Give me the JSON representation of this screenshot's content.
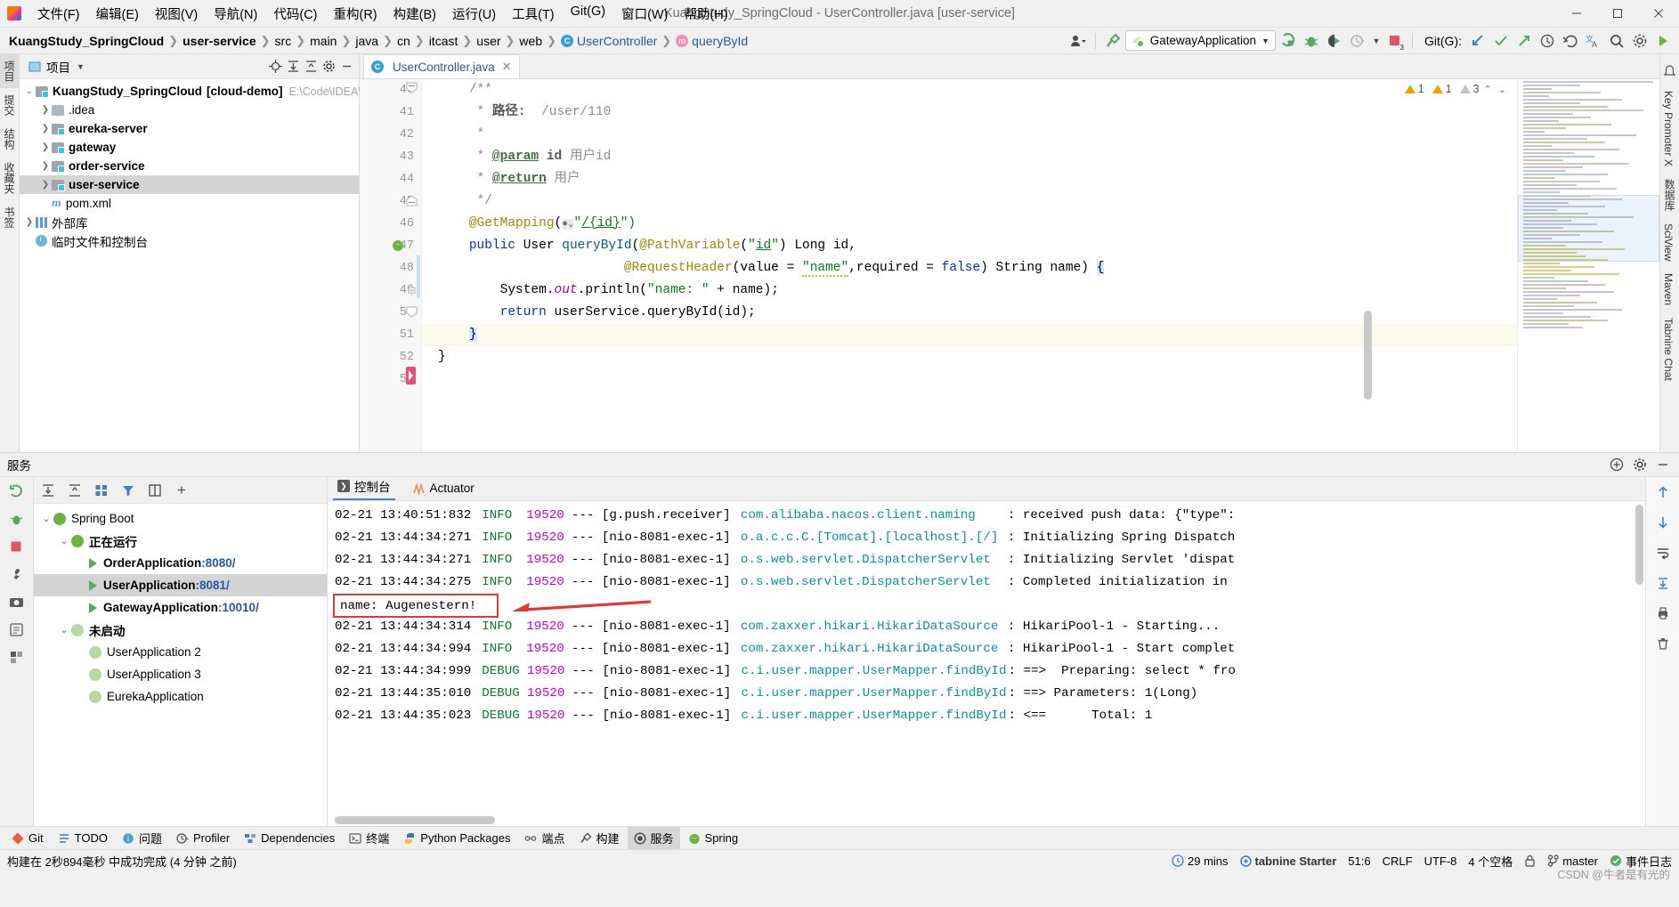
{
  "window": {
    "title": "KuangStudy_SpringCloud - UserController.java [user-service]",
    "minimize": "—",
    "maximize": "☐",
    "close": "✕"
  },
  "menu": [
    {
      "label": "文件(F)"
    },
    {
      "label": "编辑(E)"
    },
    {
      "label": "视图(V)"
    },
    {
      "label": "导航(N)"
    },
    {
      "label": "代码(C)"
    },
    {
      "label": "重构(R)"
    },
    {
      "label": "构建(B)"
    },
    {
      "label": "运行(U)"
    },
    {
      "label": "工具(T)"
    },
    {
      "label": "Git(G)"
    },
    {
      "label": "窗口(W)"
    },
    {
      "label": "帮助(H)"
    }
  ],
  "breadcrumbs": [
    {
      "label": "KuangStudy_SpringCloud",
      "bold": true
    },
    {
      "label": "user-service",
      "bold": true
    },
    {
      "label": "src"
    },
    {
      "label": "main"
    },
    {
      "label": "java"
    },
    {
      "label": "cn"
    },
    {
      "label": "itcast"
    },
    {
      "label": "user"
    },
    {
      "label": "web"
    },
    {
      "label": "UserController",
      "icon": "class-icon"
    },
    {
      "label": "queryById",
      "icon": "method-icon"
    }
  ],
  "toolbar": {
    "run_config": "GatewayApplication",
    "git_label": "Git(G):",
    "icons": [
      "profile-icon",
      "build-hammer-icon",
      "run-icon",
      "debug-icon",
      "run-with-coverage-icon",
      "profiler-icon",
      "stop-icon",
      "git-update-icon",
      "git-commit-icon",
      "git-push-icon",
      "history-icon",
      "undo-icon",
      "translate-icon",
      "search-icon",
      "settings-icon",
      "ide-icon"
    ],
    "stop_badge": "3"
  },
  "left_rail": [
    {
      "label": "项目",
      "active": true
    },
    {
      "label": "提交"
    },
    {
      "label": "结构"
    },
    {
      "label": "收藏夹"
    },
    {
      "label": "书签"
    }
  ],
  "right_rail": [
    {
      "label": "Key Promoter X"
    },
    {
      "label": "数据库"
    },
    {
      "label": "SciView"
    },
    {
      "label": "Maven"
    },
    {
      "label": "Tabnine Chat"
    }
  ],
  "project_panel": {
    "title": "项目",
    "header_icons": [
      "locate-icon",
      "expand-all-icon",
      "collapse-all-icon",
      "settings-gear-icon",
      "hide-icon"
    ],
    "tree": [
      {
        "level": 0,
        "arrow": "down",
        "icon": "module-folder",
        "label": "KuangStudy_SpringCloud",
        "bracket": "[cloud-demo]",
        "path": "E:\\Code\\IDEA\\Ku",
        "bold": true
      },
      {
        "level": 1,
        "arrow": "right",
        "icon": "plain-folder",
        "label": ".idea",
        "bold": false
      },
      {
        "level": 1,
        "arrow": "right",
        "icon": "module-folder",
        "label": "eureka-server",
        "bold": true
      },
      {
        "level": 1,
        "arrow": "right",
        "icon": "module-folder",
        "label": "gateway",
        "bold": true
      },
      {
        "level": 1,
        "arrow": "right",
        "icon": "module-folder",
        "label": "order-service",
        "bold": true
      },
      {
        "level": 1,
        "arrow": "right",
        "icon": "module-folder",
        "label": "user-service",
        "bold": true,
        "selected": true
      },
      {
        "level": 1,
        "arrow": "none",
        "icon": "maven-icon",
        "label": "pom.xml",
        "bold": false
      },
      {
        "level": 0,
        "arrow": "right",
        "icon": "library-icon",
        "label": "外部库",
        "bold": false
      },
      {
        "level": 0,
        "arrow": "none",
        "icon": "scratches-icon",
        "label": "临时文件和控制台",
        "bold": false
      }
    ]
  },
  "editor": {
    "tab": {
      "label": "UserController.java",
      "icon": "class-icon",
      "close": "✕"
    },
    "inspections": {
      "warnings": "1",
      "weak_warnings": "1",
      "typos": "3"
    },
    "first_line": 40,
    "lines": [
      {
        "n": 40,
        "tokens": [
          {
            "t": "    ",
            "c": "plain"
          },
          {
            "t": "/**",
            "c": "cmt"
          }
        ]
      },
      {
        "n": 41,
        "tokens": [
          {
            "t": "     * ",
            "c": "cmt"
          },
          {
            "t": "路径:",
            "c": "cmt-b"
          },
          {
            "t": "  /user/110",
            "c": "cmt"
          }
        ]
      },
      {
        "n": 42,
        "tokens": [
          {
            "t": "     *",
            "c": "cmt"
          }
        ]
      },
      {
        "n": 43,
        "tokens": [
          {
            "t": "     * ",
            "c": "cmt"
          },
          {
            "t": "@param",
            "c": "cmt-tag"
          },
          {
            "t": " ",
            "c": "cmt"
          },
          {
            "t": "id",
            "c": "cmt-b"
          },
          {
            "t": " 用户id",
            "c": "cmt"
          }
        ]
      },
      {
        "n": 44,
        "tokens": [
          {
            "t": "     * ",
            "c": "cmt"
          },
          {
            "t": "@return",
            "c": "cmt-tag"
          },
          {
            "t": " 用户",
            "c": "cmt"
          }
        ]
      },
      {
        "n": 45,
        "tokens": [
          {
            "t": "     */",
            "c": "cmt"
          }
        ]
      },
      {
        "n": 46,
        "tokens": [
          {
            "t": "    ",
            "c": "plain"
          },
          {
            "t": "@GetMapping",
            "c": "ann"
          },
          {
            "t": "(",
            "c": "plain"
          },
          {
            "t": "●⌄",
            "c": "gutter-web"
          },
          {
            "t": "\"",
            "c": "str"
          },
          {
            "t": "/{id}",
            "c": "ustr"
          },
          {
            "t": "\")",
            "c": "str"
          }
        ]
      },
      {
        "n": 47,
        "tokens": [
          {
            "t": "    ",
            "c": "plain"
          },
          {
            "t": "public",
            "c": "kw"
          },
          {
            "t": " User ",
            "c": "typ"
          },
          {
            "t": "queryById",
            "c": "fn"
          },
          {
            "t": "(",
            "c": "plain"
          },
          {
            "t": "@PathVariable",
            "c": "ann"
          },
          {
            "t": "(",
            "c": "plain"
          },
          {
            "t": "\"",
            "c": "str"
          },
          {
            "t": "id",
            "c": "ustr"
          },
          {
            "t": "\"",
            "c": "str"
          },
          {
            "t": ") Long id,",
            "c": "plain"
          }
        ]
      },
      {
        "n": 48,
        "tokens": [
          {
            "t": "                        ",
            "c": "plain"
          },
          {
            "t": "@RequestHeader",
            "c": "ann"
          },
          {
            "t": "(value = ",
            "c": "plain"
          },
          {
            "t": "\"name\"",
            "c": "str-wavy"
          },
          {
            "t": ",required = ",
            "c": "plain"
          },
          {
            "t": "false",
            "c": "kw"
          },
          {
            "t": ") String name) ",
            "c": "plain"
          },
          {
            "t": "{",
            "c": "brace"
          }
        ]
      },
      {
        "n": 49,
        "tokens": [
          {
            "t": "        System.",
            "c": "plain"
          },
          {
            "t": "out",
            "c": "fld-i"
          },
          {
            "t": ".println(",
            "c": "plain"
          },
          {
            "t": "\"name: \"",
            "c": "str"
          },
          {
            "t": " + name);",
            "c": "plain"
          }
        ]
      },
      {
        "n": 50,
        "tokens": [
          {
            "t": "        ",
            "c": "plain"
          },
          {
            "t": "return",
            "c": "kw"
          },
          {
            "t": " userService.queryById(id);",
            "c": "plain"
          }
        ]
      },
      {
        "n": 51,
        "tokens": [
          {
            "t": "    ",
            "c": "plain"
          },
          {
            "t": "}",
            "c": "brace"
          }
        ],
        "highlight": true
      },
      {
        "n": 52,
        "tokens": [
          {
            "t": "}",
            "c": "plain"
          }
        ]
      },
      {
        "n": 53,
        "tokens": [
          {
            "t": "",
            "c": "plain"
          }
        ]
      }
    ]
  },
  "services": {
    "title": "服务",
    "header_icons": [
      "add-service-icon",
      "settings-gear-icon",
      "hide-icon"
    ],
    "toolbar_icons": [
      "rerun-icon",
      "debug-icon",
      "stop-icon",
      "wrench-icon",
      "camera-icon",
      "dump-icon",
      "layout-icon"
    ],
    "filter_icons": [
      "expand-all-icon",
      "collapse-all-icon",
      "group-icon",
      "filter-icon",
      "split-icon",
      "add-icon"
    ],
    "tree": [
      {
        "level": 0,
        "arrow": "down",
        "icon": "spring-boot-icon",
        "label": "Spring Boot"
      },
      {
        "level": 1,
        "arrow": "down",
        "icon": "running-icon",
        "label": "正在运行",
        "bold": true
      },
      {
        "level": 2,
        "arrow": "none",
        "icon": "play-icon",
        "label": "OrderApplication",
        "port": ":8080/",
        "bold": true
      },
      {
        "level": 2,
        "arrow": "none",
        "icon": "play-icon",
        "label": "UserApplication",
        "port": ":8081/",
        "bold": true,
        "selected": true
      },
      {
        "level": 2,
        "arrow": "none",
        "icon": "play-icon",
        "label": "GatewayApplication",
        "port": ":10010/",
        "bold": true
      },
      {
        "level": 1,
        "arrow": "down",
        "icon": "stopped-icon",
        "label": "未启动",
        "bold": true
      },
      {
        "level": 2,
        "arrow": "none",
        "icon": "spring-dim-icon",
        "label": "UserApplication 2"
      },
      {
        "level": 2,
        "arrow": "none",
        "icon": "spring-dim-icon",
        "label": "UserApplication 3"
      },
      {
        "level": 2,
        "arrow": "none",
        "icon": "spring-dim-icon",
        "label": "EurekaApplication"
      }
    ],
    "tabs": [
      {
        "label": "控制台",
        "icon": "console-icon",
        "active": true
      },
      {
        "label": "Actuator",
        "icon": "actuator-icon",
        "active": false
      }
    ],
    "right_icons": [
      "scroll-up-icon",
      "scroll-down-icon",
      "soft-wrap-icon",
      "scroll-end-icon",
      "print-icon",
      "trash-icon"
    ],
    "log_lines": [
      {
        "ts": "02-21 13:40:51:832",
        "level": "INFO",
        "pid": "19520",
        "thread": "[g.push.receiver]",
        "logger": "com.alibaba.nacos.client.naming",
        "msg": ": received push data: {\"type\":"
      },
      {
        "ts": "02-21 13:44:34:271",
        "level": "INFO",
        "pid": "19520",
        "thread": "[nio-8081-exec-1]",
        "logger": "o.a.c.c.C.[Tomcat].[localhost].[/]",
        "msg": ": Initializing Spring Dispatch"
      },
      {
        "ts": "02-21 13:44:34:271",
        "level": "INFO",
        "pid": "19520",
        "thread": "[nio-8081-exec-1]",
        "logger": "o.s.web.servlet.DispatcherServlet",
        "msg": ": Initializing Servlet 'dispat"
      },
      {
        "ts": "02-21 13:44:34:275",
        "level": "INFO",
        "pid": "19520",
        "thread": "[nio-8081-exec-1]",
        "logger": "o.s.web.servlet.DispatcherServlet",
        "msg": ": Completed initialization in"
      },
      {
        "ts": "",
        "level": "",
        "pid": "",
        "thread": "",
        "logger": "",
        "msg": ""
      },
      {
        "ts": "02-21 13:44:34:314",
        "level": "INFO",
        "pid": "19520",
        "thread": "[nio-8081-exec-1]",
        "logger": "com.zaxxer.hikari.HikariDataSource",
        "msg": ": HikariPool-1 - Starting..."
      },
      {
        "ts": "02-21 13:44:34:994",
        "level": "INFO",
        "pid": "19520",
        "thread": "[nio-8081-exec-1]",
        "logger": "com.zaxxer.hikari.HikariDataSource",
        "msg": ": HikariPool-1 - Start complet"
      },
      {
        "ts": "02-21 13:44:34:999",
        "level": "DEBUG",
        "pid": "19520",
        "thread": "[nio-8081-exec-1]",
        "logger": "c.i.user.mapper.UserMapper.findById",
        "msg": ": ==>  Preparing: select * fro"
      },
      {
        "ts": "02-21 13:44:35:010",
        "level": "DEBUG",
        "pid": "19520",
        "thread": "[nio-8081-exec-1]",
        "logger": "c.i.user.mapper.UserMapper.findById",
        "msg": ": ==> Parameters: 1(Long)"
      },
      {
        "ts": "02-21 13:44:35:023",
        "level": "DEBUG",
        "pid": "19520",
        "thread": "[nio-8081-exec-1]",
        "logger": "c.i.user.mapper.UserMapper.findById",
        "msg": ": <==      Total: 1"
      }
    ],
    "highlighted_output": "name: Augenestern!"
  },
  "bottom_tabs": [
    {
      "label": "Git",
      "icon": "git-icon"
    },
    {
      "label": "TODO",
      "icon": "todo-icon"
    },
    {
      "label": "问题",
      "icon": "problems-icon"
    },
    {
      "label": "Profiler",
      "icon": "profiler-icon"
    },
    {
      "label": "Dependencies",
      "icon": "dependencies-icon"
    },
    {
      "label": "终端",
      "icon": "terminal-icon"
    },
    {
      "label": "Python Packages",
      "icon": "python-icon"
    },
    {
      "label": "端点",
      "icon": "endpoints-icon"
    },
    {
      "label": "构建",
      "icon": "build-icon"
    },
    {
      "label": "服务",
      "icon": "services-icon",
      "active": true
    },
    {
      "label": "Spring",
      "icon": "spring-icon"
    }
  ],
  "statusbar": {
    "left": "构建在 2秒894毫秒 中成功完成 (4 分钟 之前)",
    "time": "29 mins",
    "time_icon": "clock-icon",
    "tabnine": "tabnine Starter",
    "caret": "51:6",
    "line_sep": "CRLF",
    "encoding": "UTF-8",
    "indent": "4 个空格",
    "lock_icon": "lock-icon",
    "branch": "master",
    "branch_icon": "branch-icon",
    "event_log": "事件日志",
    "event_icon": "event-icon",
    "watermark": "CSDN @牛者是有光的"
  }
}
